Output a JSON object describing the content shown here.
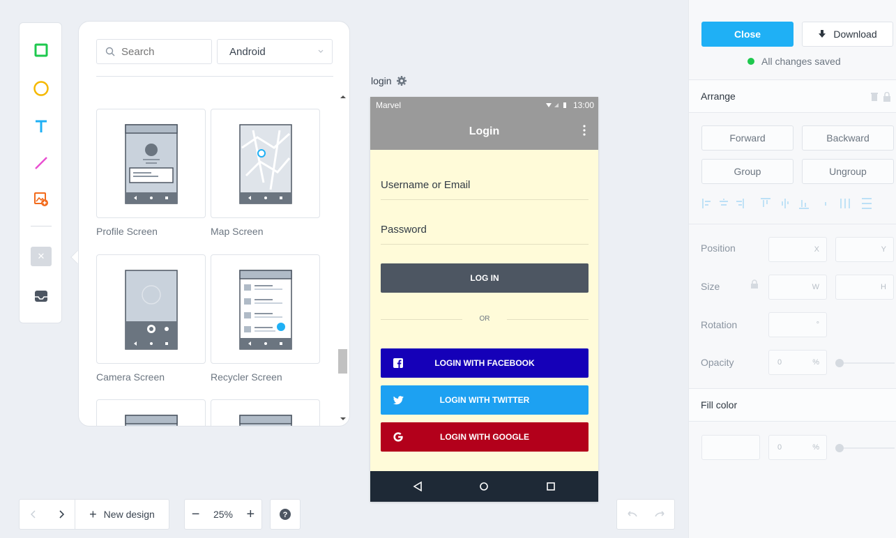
{
  "panel": {
    "search_placeholder": "Search",
    "platform_selected": "Android",
    "templates": [
      {
        "label": "Profile Screen"
      },
      {
        "label": "Map Screen"
      },
      {
        "label": "Camera Screen"
      },
      {
        "label": "Recycler Screen"
      }
    ]
  },
  "canvas": {
    "screen_name": "login",
    "status_app": "Marvel",
    "status_time": "13:00",
    "appbar_title": "Login",
    "username_placeholder": "Username or Email",
    "password_placeholder": "Password",
    "login_button": "LOG IN",
    "or_text": "OR",
    "facebook_button": "LOGIN WITH FACEBOOK",
    "twitter_button": "LOGIN WITH TWITTER",
    "google_button": "LOGIN WITH GOOGLE"
  },
  "bottom": {
    "new_design": "New design",
    "zoom": "25%"
  },
  "right": {
    "close": "Close",
    "download": "Download",
    "saved_status": "All changes saved",
    "arrange_title": "Arrange",
    "forward": "Forward",
    "backward": "Backward",
    "group": "Group",
    "ungroup": "Ungroup",
    "position_label": "Position",
    "size_label": "Size",
    "rotation_label": "Rotation",
    "opacity_label": "Opacity",
    "fill_title": "Fill color",
    "x_hint": "X",
    "y_hint": "Y",
    "w_hint": "W",
    "h_hint": "H",
    "deg_hint": "°",
    "opacity_value": "0",
    "pct_hint": "%",
    "fill_opacity_value": "0"
  },
  "colors": {
    "accent": "#1fb0f5",
    "facebook": "#1500b8",
    "twitter": "#1da1f2",
    "google": "#b3001b",
    "saved_dot": "#1ec84e"
  }
}
